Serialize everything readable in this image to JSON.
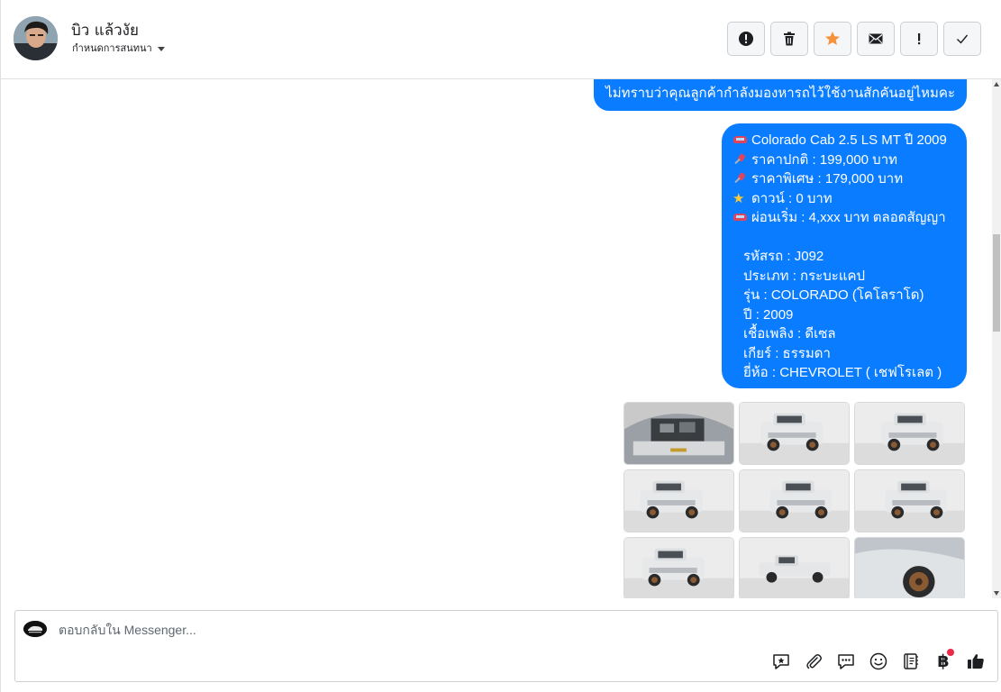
{
  "header": {
    "contact_name": "บิว แล้วงัย",
    "assign_label": "กำหนดการสนทนา",
    "actions": [
      {
        "name": "alert-button",
        "icon": "exclamation-circle-icon"
      },
      {
        "name": "delete-button",
        "icon": "trash-icon"
      },
      {
        "name": "star-button",
        "icon": "star-icon",
        "color": "#f7923b"
      },
      {
        "name": "email-button",
        "icon": "envelope-icon"
      },
      {
        "name": "important-button",
        "icon": "exclamation-icon"
      },
      {
        "name": "done-button",
        "icon": "check-icon"
      }
    ]
  },
  "messages": {
    "top_bubble": "ไม่ทราบว่าคุณลูกค้ากำลังมองหารถไว้ใช้งานสักคันอยู่ไหมคะ",
    "main_bubble": {
      "lines": [
        {
          "emoji": "car-emoji",
          "text": "Colorado Cab 2.5 LS MT ปี 2009"
        },
        {
          "emoji": "pin-emoji",
          "text": "ราคาปกติ : 199,000 บาท"
        },
        {
          "emoji": "pin-emoji",
          "text": "ราคาพิเศษ : 179,000 บาท"
        },
        {
          "emoji": "star-emoji",
          "text": "ดาวน์ : 0 บาท"
        },
        {
          "emoji": "car-emoji",
          "text": "ผ่อนเริ่ม : 4,xxx บาท ตลอดสัญญา"
        }
      ],
      "specs": [
        "รหัสรถ : J092",
        "ประเภท : กระบะแคป",
        "รุ่น : COLORADO (โคโลราโด)",
        "ปี : 2009",
        "เชื้อเพลิง : ดีเซล",
        "เกียร์ : ธรรมดา",
        "ยี่ห้อ : CHEVROLET ( เชฟโรเลต )"
      ]
    },
    "bubble_color": "#0a7cff",
    "photos": [
      {
        "name": "engine-photo"
      },
      {
        "name": "front-left-photo"
      },
      {
        "name": "front-photo"
      },
      {
        "name": "side-front-photo"
      },
      {
        "name": "rear-left-photo"
      },
      {
        "name": "rear-photo"
      },
      {
        "name": "rear-quarter-photo"
      },
      {
        "name": "side-profile-photo"
      },
      {
        "name": "wheel-closeup-photo"
      }
    ]
  },
  "composer": {
    "placeholder": "ตอบกลับใน Messenger...",
    "tools": [
      "saved-reply-icon",
      "attachment-icon",
      "chat-bubbles-icon",
      "emoji-icon",
      "notes-icon",
      "baht-icon",
      "like-icon"
    ],
    "baht_symbol": "฿"
  }
}
